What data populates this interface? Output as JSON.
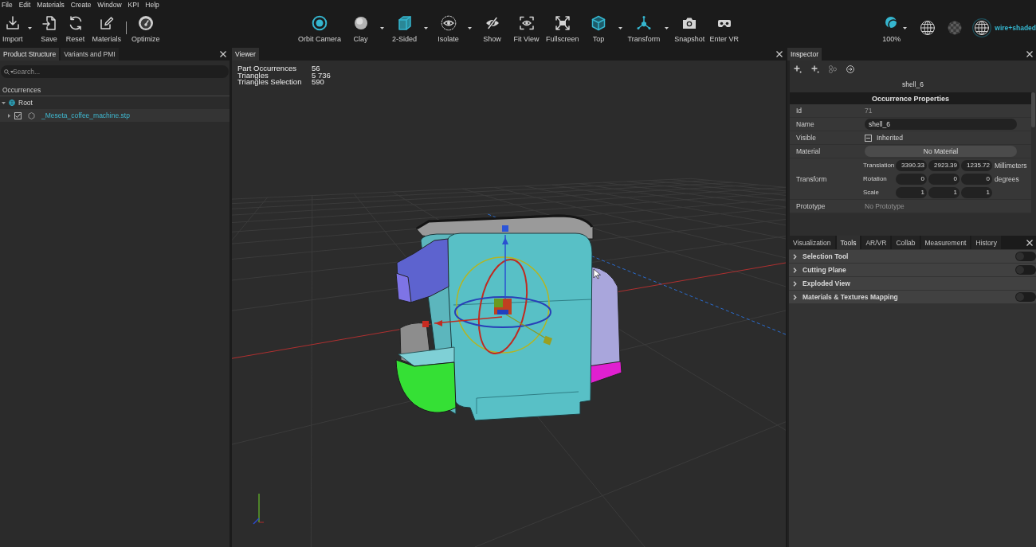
{
  "menu_bar": [
    "File",
    "Edit",
    "Materials",
    "Create",
    "Window",
    "KPI",
    "Help"
  ],
  "toolbar": {
    "left": [
      {
        "kind": "button",
        "label": "Import",
        "dropdown": true
      },
      {
        "kind": "button",
        "label": "Save",
        "dropdown": false
      },
      {
        "kind": "button",
        "label": "Reset",
        "dropdown": false
      },
      {
        "kind": "button",
        "label": "Materials",
        "dropdown": false
      },
      {
        "kind": "separator"
      },
      {
        "kind": "button",
        "label": "Optimize",
        "dropdown": false
      }
    ],
    "center": [
      {
        "label": "Orbit Camera",
        "dropdown": false
      },
      {
        "label": "Clay",
        "dropdown": true
      },
      {
        "label": "2-Sided",
        "dropdown": true
      },
      {
        "label": "Isolate",
        "dropdown": true
      },
      {
        "label": "Show",
        "dropdown": false
      },
      {
        "label": "Fit View",
        "dropdown": false
      },
      {
        "label": "Fullscreen",
        "dropdown": false
      },
      {
        "label": "Top",
        "dropdown": true
      },
      {
        "label": "Transform",
        "dropdown": true
      },
      {
        "label": "Snapshot",
        "dropdown": false
      },
      {
        "label": "Enter VR",
        "dropdown": false
      }
    ],
    "opacity": {
      "label": "100%",
      "dropdown": true
    },
    "render_modes": [
      {
        "selected": false
      },
      {
        "selected": false
      },
      {
        "selected": true,
        "label": "wire+shaded"
      }
    ]
  },
  "product_structure": {
    "tabs": [
      {
        "label": "Product Structure",
        "selected": true
      },
      {
        "label": "Variants and PMI",
        "selected": false
      }
    ],
    "search": {
      "placeholder": "Search..."
    },
    "heading": "Occurrences",
    "tree": [
      {
        "kind": "root",
        "label": "Root",
        "expanded": true,
        "selected": false,
        "children": [
          {
            "kind": "part",
            "label": "_Meseta_coffee_machine.stp",
            "expanded": false,
            "checked": true,
            "selected": true
          }
        ]
      }
    ]
  },
  "viewer": {
    "tab": "Viewer",
    "stats": [
      {
        "label": "Part Occurrences",
        "value": "56"
      },
      {
        "label": "Triangles",
        "value": "5 736"
      },
      {
        "label": "Triangles Selection",
        "value": "590"
      }
    ]
  },
  "inspector": {
    "tab": "Inspector",
    "title": "shell_6",
    "section": "Occurrence Properties",
    "properties": [
      {
        "kind": "readonly",
        "label": "Id",
        "value": "71"
      },
      {
        "kind": "field",
        "label": "Name",
        "value": "shell_6"
      },
      {
        "kind": "checkbox",
        "label": "Visible",
        "indeterminate": true,
        "text": "Inherited"
      },
      {
        "kind": "button",
        "label": "Material",
        "value": "No Material"
      },
      {
        "kind": "transform",
        "label": "Transform",
        "rows": [
          {
            "label": "Translation",
            "values": [
              "3390.33",
              "2923.39",
              "1235.72"
            ],
            "unit": "Millimeters"
          },
          {
            "label": "Rotation",
            "values": [
              "0",
              "0",
              "0"
            ],
            "unit": "degrees"
          },
          {
            "label": "Scale",
            "values": [
              "1",
              "1",
              "1"
            ]
          }
        ]
      },
      {
        "kind": "readonly",
        "label": "Prototype",
        "value": "No Prototype"
      }
    ]
  },
  "tools_panel": {
    "tabs": [
      {
        "label": "Visualization",
        "selected": false
      },
      {
        "label": "Tools",
        "selected": true
      },
      {
        "label": "AR/VR",
        "selected": false
      },
      {
        "label": "Collab",
        "selected": false
      },
      {
        "label": "Measurement",
        "selected": false
      },
      {
        "label": "History",
        "selected": false
      }
    ],
    "sections": [
      {
        "kind": "toggle",
        "label": "Selection Tool",
        "expanded": false,
        "on": false
      },
      {
        "kind": "toggle",
        "label": "Cutting Plane",
        "expanded": false,
        "on": false
      },
      {
        "kind": "plain",
        "label": "Exploded View",
        "expanded": false
      },
      {
        "kind": "toggle",
        "label": "Materials & Textures Mapping",
        "expanded": false,
        "on": false
      }
    ]
  }
}
